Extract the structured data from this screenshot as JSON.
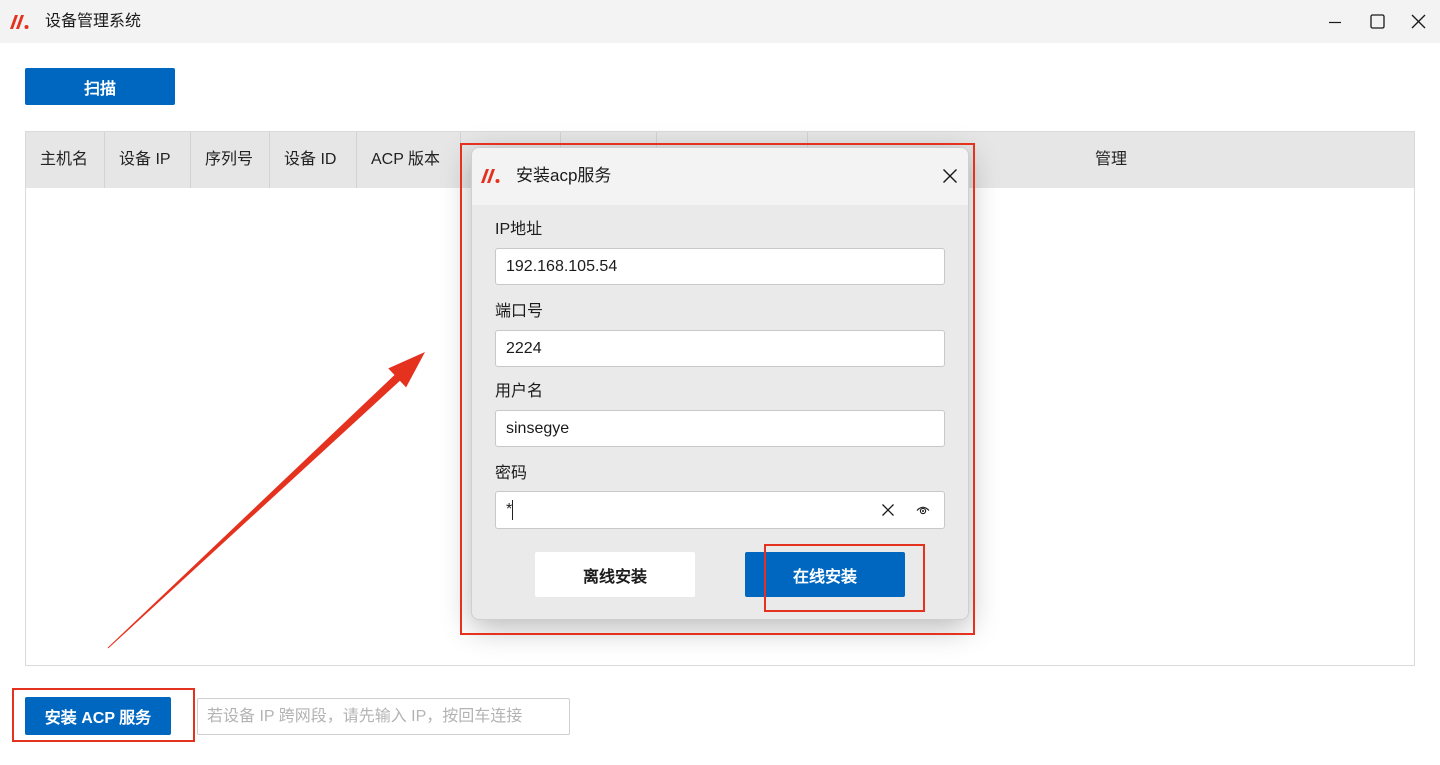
{
  "window": {
    "title": "设备管理系统"
  },
  "toolbar": {
    "scan_label": "扫描"
  },
  "table": {
    "columns": [
      "主机名",
      "设备 IP",
      "序列号",
      "设备 ID",
      "ACP 版本",
      "管理"
    ],
    "rows": []
  },
  "footer": {
    "install_label": "安装 ACP 服务",
    "ip_input_placeholder": "若设备 IP 跨网段，请先输入 IP，按回车连接"
  },
  "dialog": {
    "title": "安装acp服务",
    "fields": {
      "ip": {
        "label": "IP地址",
        "value": "192.168.105.54"
      },
      "port": {
        "label": "端口号",
        "value": "2224"
      },
      "username": {
        "label": "用户名",
        "value": "sinsegye"
      },
      "password": {
        "label": "密码",
        "value": "*"
      }
    },
    "buttons": {
      "offline": "离线安装",
      "online": "在线安装"
    }
  },
  "icons": {
    "app_logo": "app-logo-icon",
    "minimize": "minimize-icon",
    "maximize": "maximize-icon",
    "close": "close-icon",
    "dialog_close": "dialog-close-icon",
    "password_clear": "clear-icon",
    "password_reveal": "eye-icon"
  },
  "colors": {
    "accent": "#0067c0",
    "annotation": "#e5321e",
    "logo": "#e5321e",
    "table_header_bg": "#e6e6e6"
  }
}
